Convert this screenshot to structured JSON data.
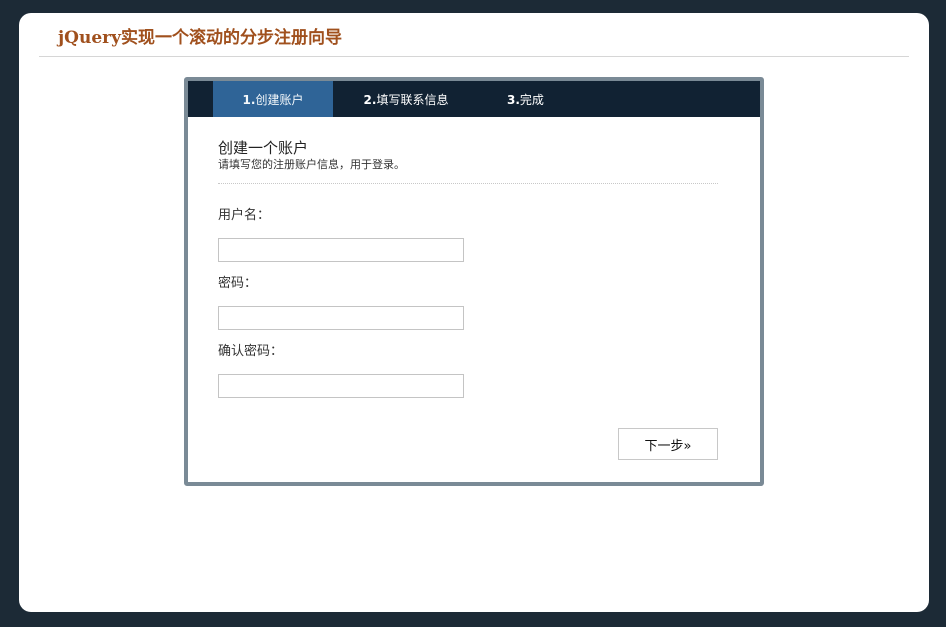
{
  "header": {
    "title": "jQuery实现一个滚动的分步注册向导"
  },
  "wizard": {
    "tabs": [
      {
        "num": "1.",
        "label": "创建账户"
      },
      {
        "num": "2.",
        "label": "填写联系信息"
      },
      {
        "num": "3.",
        "label": "完成"
      }
    ],
    "active_tab": 1,
    "step": {
      "title": "创建一个账户",
      "description": "请填写您的注册账户信息，用于登录。"
    },
    "fields": [
      {
        "label": "用户名：",
        "value": ""
      },
      {
        "label": "密码：",
        "value": ""
      },
      {
        "label": "确认密码：",
        "value": ""
      }
    ],
    "next_label": "下一步»"
  },
  "colors": {
    "background": "#1c2a36",
    "title": "#a0501d",
    "tab_bar": "#112233",
    "tab_active": "#2f6497",
    "wizard_border": "#7a8a96"
  }
}
